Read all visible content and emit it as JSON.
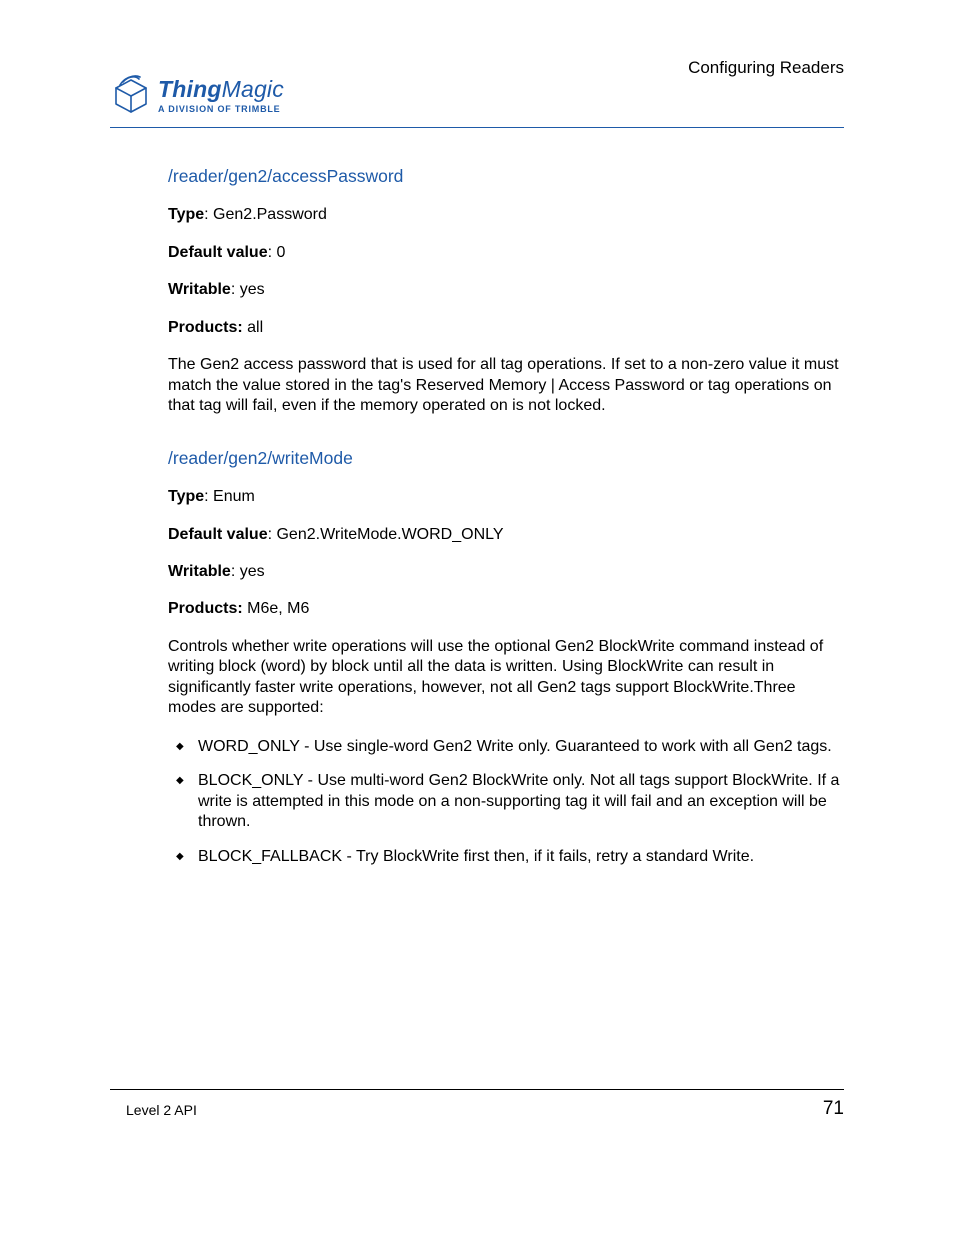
{
  "header": {
    "title": "Configuring Readers",
    "logo_main_a": "Thing",
    "logo_main_b": "Magic",
    "logo_sub": "A DIVISION OF TRIMBLE"
  },
  "sections": [
    {
      "heading": "/reader/gen2/accessPassword",
      "fields": {
        "type_label": "Type",
        "type_value": ": Gen2.Password",
        "default_label": "Default value",
        "default_value": ": 0",
        "writable_label": "Writable",
        "writable_value": ": yes",
        "products_label": "Products:",
        "products_value": " all"
      },
      "paragraph": "The Gen2 access password that is used for all tag operations. If set to a non-zero value it must match the value stored in the tag's Reserved Memory | Access Password or tag operations on that tag will fail, even if the memory operated on is not locked."
    },
    {
      "heading": "/reader/gen2/writeMode",
      "fields": {
        "type_label": "Type",
        "type_value": ": Enum",
        "default_label": "Default value",
        "default_value": ": Gen2.WriteMode.WORD_ONLY",
        "writable_label": "Writable",
        "writable_value": ": yes",
        "products_label": "Products:",
        "products_value": " M6e, M6"
      },
      "paragraph": "Controls whether write operations will use the optional Gen2 BlockWrite command instead of writing block (word) by block until all the data is written. Using BlockWrite can result in significantly faster write operations, however, not all Gen2 tags support BlockWrite.Three modes are supported:",
      "list": [
        "WORD_ONLY - Use single-word Gen2 Write only. Guaranteed to work with all Gen2 tags.",
        "BLOCK_ONLY - Use multi-word Gen2 BlockWrite only. Not all tags support BlockWrite. If a write is attempted in this mode on a non-supporting tag it will fail and an exception will be thrown.",
        "BLOCK_FALLBACK - Try BlockWrite first then, if it fails, retry a standard Write."
      ]
    }
  ],
  "footer": {
    "left": "Level 2 API",
    "page": "71"
  }
}
